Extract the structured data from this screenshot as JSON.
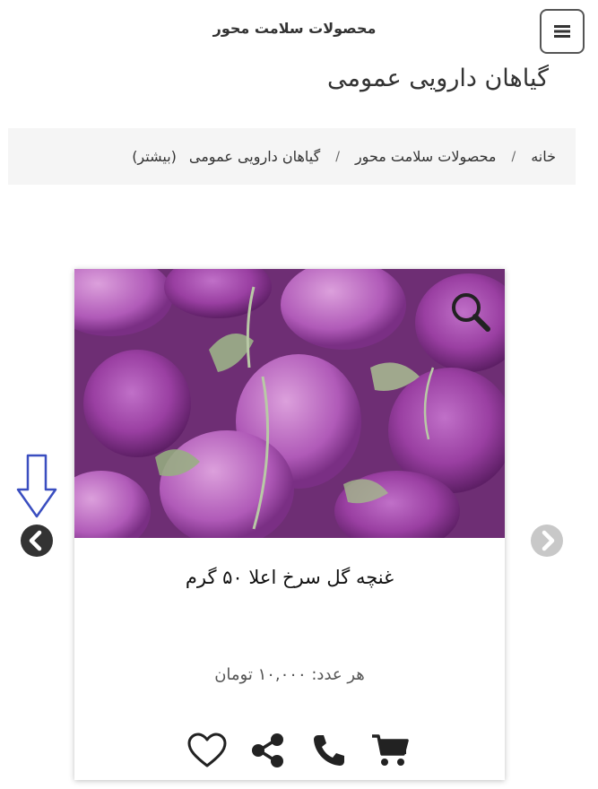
{
  "header": {
    "brand": "محصولات سلامت محور",
    "menu_icon": "hamburger-icon"
  },
  "page": {
    "title": "گیاهان دارویی عمومی"
  },
  "breadcrumb": {
    "home": "خانه",
    "category": "محصولات سلامت محور",
    "current": "گیاهان دارویی عمومی",
    "more": "(بیشتر)",
    "separator": "/"
  },
  "product": {
    "name": "غنچه گل سرخ اعلا ۵۰ گرم",
    "price": "هر عدد: ۱۰,۰۰۰ تومان",
    "image_icon": "rose-buds-photo",
    "zoom_icon": "magnifier-icon"
  },
  "actions": {
    "icons": [
      "cart-icon",
      "phone-icon",
      "share-icon",
      "heart-icon"
    ]
  },
  "carousel": {
    "prev_icon": "chevron-left-icon",
    "next_icon": "chevron-right-icon",
    "hint_icon": "down-arrow-icon"
  },
  "colors": {
    "accent": "#3a4ec0",
    "nav_active": "#333333",
    "nav_inactive": "#c8c8c8"
  }
}
